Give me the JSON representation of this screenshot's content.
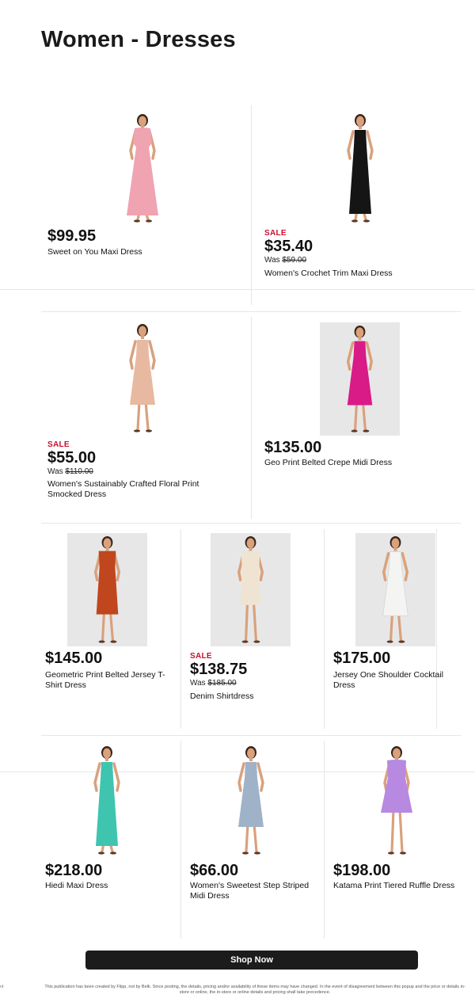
{
  "page": {
    "title": "Women - Dresses"
  },
  "products": [
    {
      "sale": "",
      "price": "$99.95",
      "was_prefix": "",
      "was_price": "",
      "name": "Sweet on You Maxi Dress",
      "dress_color": "#f0a3b1",
      "style": "maxi-flutter"
    },
    {
      "sale": "SALE",
      "price": "$35.40",
      "was_prefix": "Was ",
      "was_price": "$59.00",
      "name": "Women's Crochet Trim Maxi Dress",
      "dress_color": "#151515",
      "style": "maxi-strap"
    },
    {
      "sale": "SALE",
      "price": "$55.00",
      "was_prefix": "Was ",
      "was_price": "$110.00",
      "name": "Women's Sustainably Crafted Floral Print Smocked Dress",
      "dress_color": "#e8b9a1",
      "style": "midi-strap"
    },
    {
      "sale": "",
      "price": "$135.00",
      "was_prefix": "",
      "was_price": "",
      "name": "Geo Print Belted Crepe Midi Dress",
      "dress_color": "#d81b86",
      "style": "midi-strap"
    },
    {
      "sale": "",
      "price": "$145.00",
      "was_prefix": "",
      "was_price": "",
      "name": "Geometric Print Belted Jersey T-Shirt Dress",
      "dress_color": "#c0461d",
      "style": "midi-sleeve"
    },
    {
      "sale": "SALE",
      "price": "$138.75",
      "was_prefix": "Was ",
      "was_price": "$185.00",
      "name": "Denim Shirtdress",
      "dress_color": "#efe4d2",
      "style": "shirt"
    },
    {
      "sale": "",
      "price": "$175.00",
      "was_prefix": "",
      "was_price": "",
      "name": "Jersey One Shoulder Cocktail Dress",
      "dress_color": "#f4f4f2",
      "style": "midi-strap"
    },
    {
      "sale": "",
      "price": "$218.00",
      "was_prefix": "",
      "was_price": "",
      "name": "Hiedi Maxi Dress",
      "dress_color": "#3fc4b0",
      "style": "maxi-strap"
    },
    {
      "sale": "",
      "price": "$66.00",
      "was_prefix": "",
      "was_price": "",
      "name": "Women's Sweetest Step Striped Midi Dress",
      "dress_color": "#9fb2c8",
      "style": "midi-strap"
    },
    {
      "sale": "",
      "price": "$198.00",
      "was_prefix": "",
      "was_price": "",
      "name": "Katama Print Tiered Ruffle Dress",
      "dress_color": "#b789e0",
      "style": "mini-flutter"
    }
  ],
  "shop_now": {
    "label": "Shop Now"
  },
  "footer": {
    "disclaimer": "This publication has been created by Flipp, not by Belk. Since posting, the details, pricing and/or availability of these items may have changed. In the event of disagreement between this popup and the price or details in-store or online, the in-store or online details and pricing shall take precedence.",
    "edge_text": "nt"
  }
}
